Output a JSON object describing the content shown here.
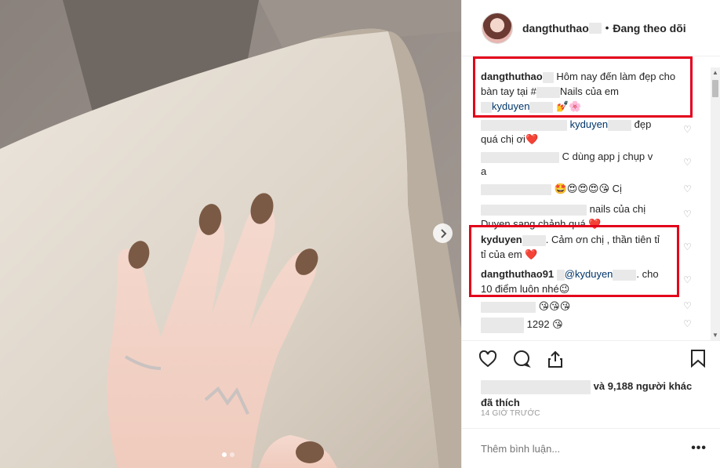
{
  "post": {
    "username": "dangthuthao",
    "separator": "•",
    "follow_status": "Đang theo dõi"
  },
  "comments": [
    {
      "user": "dangthuthao",
      "text_a": "Hôm nay đến làm đẹp cho",
      "text_b": "bàn tay tại #",
      "text_c": "Nails của em",
      "mention": "kyduyen",
      "emoji": "💅🌸"
    },
    {
      "mention": "kyduyen",
      "text": "đẹp",
      "text_b": "quá chị ơi❤️"
    },
    {
      "text": "C dùng app j chụp v",
      "text_b": "a"
    },
    {
      "text": "🤩😍😍😍😘 Cị"
    },
    {
      "text": "nails của chị",
      "text_b": "Duyen sang chảnh quá ❤️"
    },
    {
      "user": "kyduyen",
      "text_a": "Cảm ơn chị , thần tiên tỉ",
      "text_b": "tỉ của em ❤️"
    },
    {
      "user": "dangthuthao91",
      "mention": "@kyduyen",
      "text_a": "cho",
      "text_b": "10 điểm luôn nhé😉"
    },
    {
      "text": "😘😘😘"
    },
    {
      "text": "1292 😘"
    }
  ],
  "likes": {
    "text_a": "và 9,188 người khác",
    "text_b": "đã thích"
  },
  "timestamp": "14 GIỜ TRƯỚC",
  "add_comment": {
    "placeholder": "Thêm bình luận..."
  },
  "more_label": "•••",
  "colors": {
    "highlight": "#e3001b",
    "mention": "#003569"
  }
}
